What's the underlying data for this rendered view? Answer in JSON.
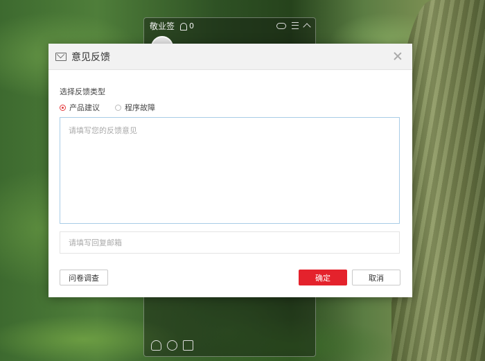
{
  "widget": {
    "title": "敬业签",
    "notification_count": "0"
  },
  "dialog": {
    "title": "意见反馈",
    "type_section_label": "选择反馈类型",
    "options": [
      {
        "label": "产品建议",
        "checked": true
      },
      {
        "label": "程序故障",
        "checked": false
      }
    ],
    "feedback_placeholder": "请填写您的反馈意见",
    "email_placeholder": "请填写回复邮箱",
    "buttons": {
      "survey": "问卷调查",
      "confirm": "确定",
      "cancel": "取消"
    }
  },
  "colors": {
    "accent": "#e4222c",
    "input_focus_border": "#a8cce6"
  }
}
